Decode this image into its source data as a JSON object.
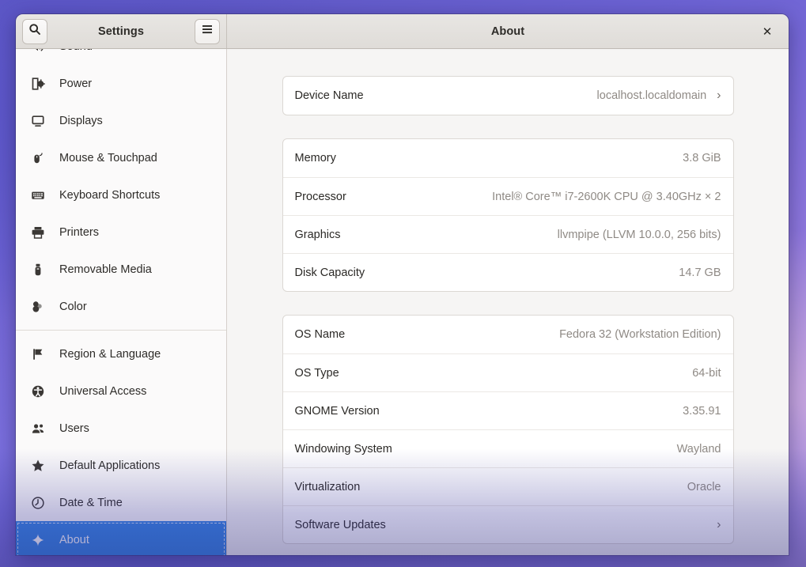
{
  "window": {
    "sidebar_title": "Settings",
    "content_title": "About",
    "search_icon": "search-icon",
    "menu_icon": "hamburger-menu-icon",
    "close_icon": "close-icon",
    "close_glyph": "✕",
    "accent_color": "#3584e4"
  },
  "sidebar": {
    "items": [
      {
        "label": "Sound",
        "icon": "speaker-icon",
        "selected": false,
        "clipped": true
      },
      {
        "label": "Power",
        "icon": "power-plug-icon",
        "selected": false
      },
      {
        "label": "Displays",
        "icon": "display-monitor-icon",
        "selected": false
      },
      {
        "label": "Mouse & Touchpad",
        "icon": "mouse-icon",
        "selected": false
      },
      {
        "label": "Keyboard Shortcuts",
        "icon": "keyboard-icon",
        "selected": false
      },
      {
        "label": "Printers",
        "icon": "printer-icon",
        "selected": false
      },
      {
        "label": "Removable Media",
        "icon": "usb-drive-icon",
        "selected": false
      },
      {
        "label": "Color",
        "icon": "color-circles-icon",
        "selected": false
      },
      {
        "label": "Region & Language",
        "icon": "flag-icon",
        "selected": false
      },
      {
        "label": "Universal Access",
        "icon": "accessibility-icon",
        "selected": false
      },
      {
        "label": "Users",
        "icon": "users-icon",
        "selected": false
      },
      {
        "label": "Default Applications",
        "icon": "star-icon",
        "selected": false
      },
      {
        "label": "Date & Time",
        "icon": "clock-icon",
        "selected": false
      },
      {
        "label": "About",
        "icon": "sparkle-icon",
        "selected": true
      }
    ],
    "separator_after_index": 7
  },
  "main": {
    "cards": [
      {
        "name": "device-name-card",
        "rows": [
          {
            "label": "Device Name",
            "value": "localhost.localdomain",
            "chevron": true
          }
        ]
      },
      {
        "name": "hardware-card",
        "rows": [
          {
            "label": "Memory",
            "value": "3.8 GiB",
            "chevron": false
          },
          {
            "label": "Processor",
            "value": "Intel® Core™ i7-2600K CPU @ 3.40GHz × 2",
            "chevron": false
          },
          {
            "label": "Graphics",
            "value": "llvmpipe (LLVM 10.0.0, 256 bits)",
            "chevron": false
          },
          {
            "label": "Disk Capacity",
            "value": "14.7 GB",
            "chevron": false
          }
        ]
      },
      {
        "name": "os-card",
        "rows": [
          {
            "label": "OS Name",
            "value": "Fedora 32 (Workstation Edition)",
            "chevron": false
          },
          {
            "label": "OS Type",
            "value": "64-bit",
            "chevron": false
          },
          {
            "label": "GNOME Version",
            "value": "3.35.91",
            "chevron": false
          },
          {
            "label": "Windowing System",
            "value": "Wayland",
            "chevron": false
          },
          {
            "label": "Virtualization",
            "value": "Oracle",
            "chevron": false
          },
          {
            "label": "Software Updates",
            "value": "",
            "chevron": true
          }
        ]
      }
    ],
    "chevron_glyph": "›"
  }
}
